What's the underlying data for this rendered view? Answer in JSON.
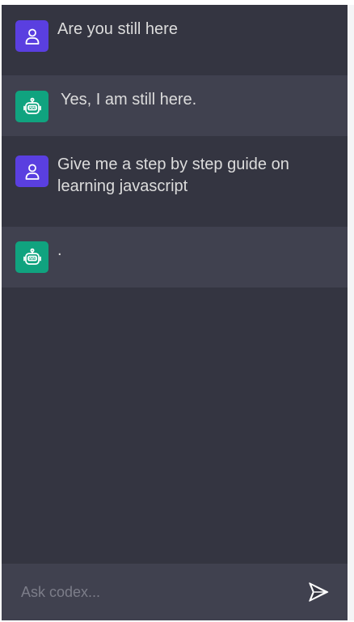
{
  "messages": [
    {
      "role": "user",
      "avatar_icon": "user-icon",
      "text": "Are you still here"
    },
    {
      "role": "bot",
      "avatar_icon": "robot-icon",
      "text": "Yes, I am still here."
    },
    {
      "role": "user",
      "avatar_icon": "user-icon",
      "text": "Give me a step by step guide on learning javascript"
    },
    {
      "role": "bot",
      "avatar_icon": "robot-icon",
      "text": "."
    }
  ],
  "input": {
    "placeholder": "Ask codex...",
    "value": ""
  },
  "send_button": {
    "icon": "send-icon"
  },
  "colors": {
    "chat_background": "#343541",
    "bot_row_background": "#40414f",
    "user_avatar": "#5a3fe0",
    "bot_avatar": "#10a37f",
    "text": "#dcdcdc"
  }
}
